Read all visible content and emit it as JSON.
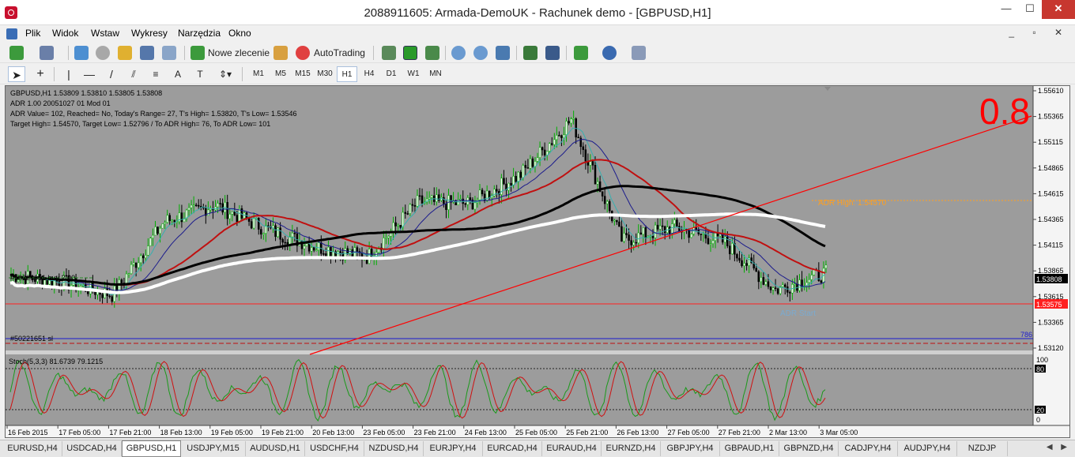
{
  "window": {
    "title": "2088911605: Armada-DemoUK - Rachunek demo - [GBPUSD,H1]",
    "minimize": "—",
    "maximize": "☐",
    "close": "✕"
  },
  "menu": {
    "items": [
      "Plik",
      "Widok",
      "Wstaw",
      "Wykresy",
      "Narzędzia",
      "Okno"
    ],
    "mdi_controls": "_ ▫ ✕"
  },
  "toolbar": {
    "new_order": "Nowe zlecenie",
    "autotrading": "AutoTrading",
    "timeframes": [
      "M1",
      "M5",
      "M15",
      "M30",
      "H1",
      "H4",
      "D1",
      "W1",
      "MN"
    ],
    "active_timeframe": "H1",
    "search_placeholder": ""
  },
  "chart": {
    "info_lines": [
      "GBPUSD,H1  1.53809 1.53810 1.53805 1.53808",
      "ADR 1.00 20051027 01 Mod 01",
      "ADR Value= 102, Reached= No, Today's Range= 27, T's High= 1.53820, T's Low= 1.53546",
      "Target High= 1.54570, Target Low= 1.52796 / To ADR High= 76, To ADR Low= 101"
    ],
    "big_number": "0.8",
    "price_scale": [
      "1.55610",
      "1.55365",
      "1.55115",
      "1.54865",
      "1.54615",
      "1.54365",
      "1.54115",
      "1.53865",
      "1.53615",
      "1.53365",
      "1.53120"
    ],
    "current_price": "1.53808",
    "red_level_price": "1.53575",
    "labels": {
      "adr_high": "ADR High: 1.54570",
      "adr_start": "ADR Start",
      "buy_label": "#50221651 buy 2.00",
      "sl_label": "#50221651 sl",
      "fib_786": "786"
    },
    "stoch": {
      "label": "Stoch(5,3,3) 81.6739 79.1215",
      "levels": [
        "100",
        "80",
        "20",
        "0"
      ]
    },
    "time_axis": [
      "16 Feb 2015",
      "17 Feb 05:00",
      "17 Feb 21:00",
      "18 Feb 13:00",
      "19 Feb 05:00",
      "19 Feb 21:00",
      "20 Feb 13:00",
      "23 Feb 05:00",
      "23 Feb 21:00",
      "24 Feb 13:00",
      "25 Feb 05:00",
      "25 Feb 21:00",
      "26 Feb 13:00",
      "27 Feb 05:00",
      "27 Feb 21:00",
      "2 Mar 13:00",
      "3 Mar 05:00"
    ]
  },
  "chart_data": {
    "type": "line",
    "symbol": "GBPUSD",
    "timeframe": "H1",
    "x": [
      "16 Feb 2015",
      "17 Feb 05:00",
      "17 Feb 21:00",
      "18 Feb 13:00",
      "19 Feb 05:00",
      "19 Feb 21:00",
      "20 Feb 13:00",
      "23 Feb 05:00",
      "23 Feb 21:00",
      "24 Feb 13:00",
      "25 Feb 05:00",
      "25 Feb 21:00",
      "26 Feb 13:00",
      "27 Feb 05:00",
      "27 Feb 21:00",
      "2 Mar 13:00",
      "3 Mar 05:00"
    ],
    "series": [
      {
        "values": [
          1.5378,
          1.5371,
          1.5358,
          1.5431,
          1.5448,
          1.5424,
          1.5406,
          1.5396,
          1.5451,
          1.5449,
          1.5478,
          1.5533,
          1.5412,
          1.5426,
          1.5411,
          1.5363,
          1.538
        ]
      }
    ],
    "ylim": [
      1.5305,
      1.5565
    ],
    "grid": true
  },
  "tabs": [
    "EURUSD,H4",
    "USDCAD,H4",
    "GBPUSD,H1",
    "USDJPY,M15",
    "AUDUSD,H1",
    "USDCHF,H4",
    "NZDUSD,H4",
    "EURJPY,H4",
    "EURCAD,H4",
    "EURAUD,H4",
    "EURNZD,H4",
    "GBPJPY,H4",
    "GBPAUD,H1",
    "GBPNZD,H4",
    "CADJPY,H4",
    "AUDJPY,H4",
    "NZDJP"
  ],
  "active_tab": "GBPUSD,H1",
  "tab_arrows": "◀ ▶",
  "colors": {
    "chart_bg": "#9c9c9c",
    "bull_candle": "#00b000",
    "bear_candle": "#000000",
    "ma_black": "#000000",
    "ma_white": "#ffffff",
    "ma_red": "#c01010",
    "ma_blue": "#1c1c8c",
    "ma_teal": "#38b0b0",
    "trendline": "#ff0000",
    "adr_high": "#ff9900"
  }
}
